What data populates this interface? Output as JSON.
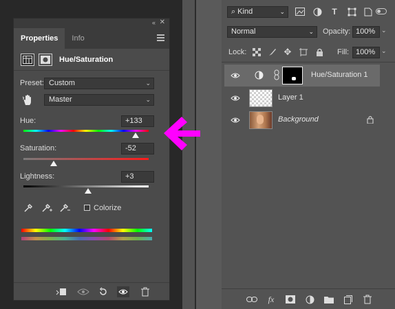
{
  "properties": {
    "tabs": [
      "Properties",
      "Info"
    ],
    "active_tab": "Properties",
    "adjustment_title": "Hue/Saturation",
    "preset_label": "Preset:",
    "preset_value": "Custom",
    "channel_value": "Master",
    "hue_label": "Hue:",
    "hue_value": "+133",
    "saturation_label": "Saturation:",
    "saturation_value": "-52",
    "lightness_label": "Lightness:",
    "lightness_value": "+3",
    "colorize_label": "Colorize",
    "colorize_checked": false
  },
  "layers": {
    "filter_kind": "Kind",
    "blend_mode": "Normal",
    "opacity_label": "Opacity:",
    "opacity_value": "100%",
    "lock_label": "Lock:",
    "fill_label": "Fill:",
    "fill_value": "100%",
    "items": [
      {
        "name": "Hue/Saturation 1",
        "selected": true,
        "visible": true
      },
      {
        "name": "Layer 1",
        "selected": false,
        "visible": true
      },
      {
        "name": "Background",
        "selected": false,
        "visible": true,
        "italic": true,
        "locked": true
      }
    ]
  },
  "colors": {
    "annotation_arrow": "#ff00ff",
    "panel_bg": "#4b4b4b",
    "selected_layer": "#6a6a6a"
  }
}
